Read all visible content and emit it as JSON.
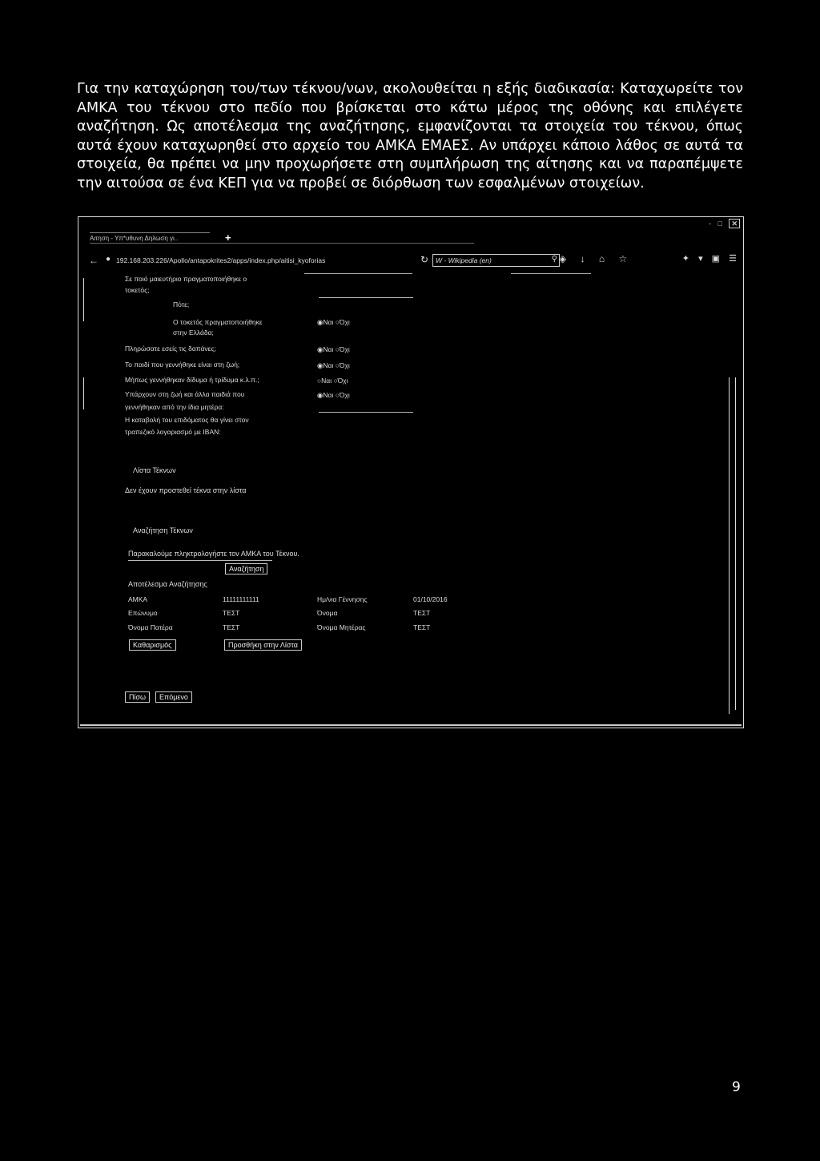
{
  "intro_text": "Για την καταχώρηση του/των τέκνου/νων, ακολουθείται η εξής διαδικασία: Καταχωρείτε τον ΑΜΚΑ του τέκνου στο πεδίο που βρίσκεται στο κάτω μέρος της οθόνης και επιλέγετε αναζήτηση. Ως αποτέλεσμα της αναζήτησης, εμφανίζονται τα στοιχεία του τέκνου, όπως αυτά έχουν καταχωρηθεί στο αρχείο του ΑΜΚΑ ΕΜΑΕΣ. Αν υπάρχει κάποιο λάθος σε αυτά τα στοιχεία, θα πρέπει να μην προχωρήσετε στη συμπλήρωση της αίτησης και να παραπέμψετε την αιτούσα σε ένα ΚΕΠ για να προβεί σε διόρθωση των εσφαλμένων στοιχείων.",
  "page_number": "9",
  "browser": {
    "tab_title": "Αιτηση - Υπ*υθυνη Δηλωση γι..",
    "new_tab": "+",
    "url": "192.168.203.226/Apollo/antapokrites2/apps/index.php/aitisi_kyoforias",
    "search_placeholder": "W - Wikipedia (en)",
    "window_controls": [
      "-",
      "□",
      "✕"
    ]
  },
  "form": {
    "q_maternity": "Σε ποιό μαιευτήριο πραγματοποιήθηκε ο",
    "q_maternity_2": "τοκετός;",
    "q_when": "Πότε;",
    "q_greece": "Ο τοκετός πραγματοποιήθηκε",
    "q_greece_2": "στην Ελλάδα;",
    "q_expenses": "Πληρώσατε εσείς τις δαπάνες;",
    "q_alive": "Το παιδί που γεννήθηκε είναι στη ζωή;",
    "q_twins": "Μήπως γεννήθηκαν δίδυμα ή τρίδυμα κ.λ.π.;",
    "q_others": "Υπάρχουν στη ζωή και άλλα παιδιά που",
    "q_others_2": "γεννήθηκαν από την ίδια μητέρα:",
    "q_iban": "Η καταβολή του επιδόματος θα γίνει στον",
    "q_iban_2": "τραπεζικό λογαριασμό με IBAN:",
    "yes": "Ναι",
    "no": "Όχι"
  },
  "children_list": {
    "title": "Λίστα Τέκνων",
    "empty_message": "Δεν έχουν προστεθεί τέκνα στην λίστα"
  },
  "search": {
    "title": "Αναζήτηση Τέκνων",
    "instruction": "Παρακαλούμε πληκτρολογήστε τον ΑΜΚΑ του Τέκνου.",
    "search_button": "Αναζήτηση",
    "results_title": "Αποτέλεσμα Αναζήτησης",
    "labels": {
      "amka": "ΑΜΚΑ",
      "surname": "Επώνυμο",
      "father": "Όνομα Πατέρα",
      "birthdate": "Ημ/νια Γέννησης",
      "name": "Όνομα",
      "mother": "Όνομα Μητέρας"
    },
    "values": {
      "amka": "11111111111",
      "surname": "ΤΕΣΤ",
      "father": "ΤΕΣΤ",
      "birthdate": "01/10/2016",
      "name": "ΤΕΣΤ",
      "mother": "ΤΕΣΤ"
    },
    "clear_button": "Καθαρισμός",
    "add_button": "Προσθήκη στην Λίστα"
  },
  "nav": {
    "back_button": "Πίσω",
    "next_button": "Επόμενο"
  }
}
